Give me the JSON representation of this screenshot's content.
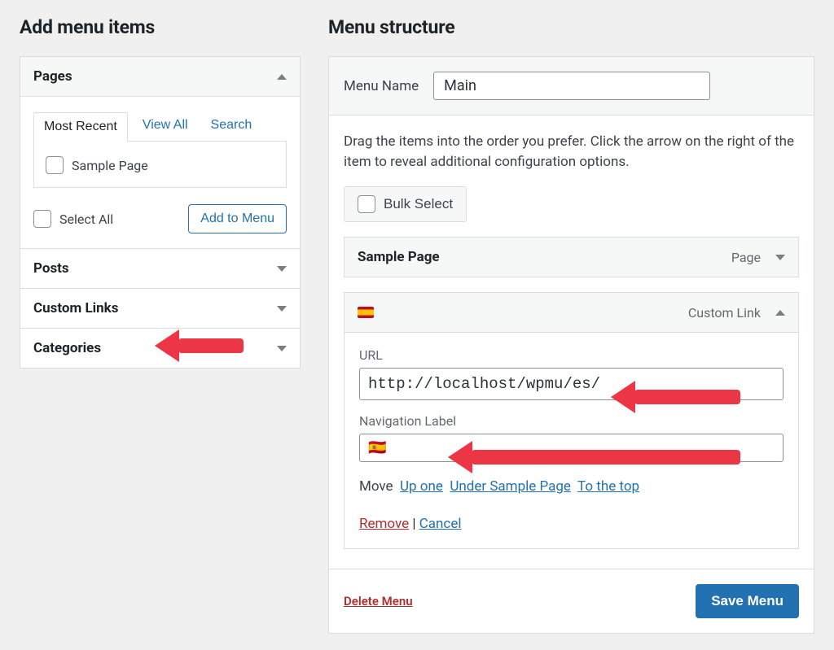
{
  "left": {
    "title": "Add menu items",
    "pages": {
      "header": "Pages",
      "tabs": {
        "recent": "Most Recent",
        "view_all": "View All",
        "search": "Search"
      },
      "items": [
        "Sample Page"
      ],
      "select_all": "Select All",
      "add_to_menu": "Add to Menu"
    },
    "posts_header": "Posts",
    "custom_links_header": "Custom Links",
    "categories_header": "Categories"
  },
  "right": {
    "title": "Menu structure",
    "menu_name_label": "Menu Name",
    "menu_name_value": "Main",
    "instructions": "Drag the items into the order you prefer. Click the arrow on the right of the item to reveal additional configuration options.",
    "bulk_select": "Bulk Select",
    "item_sample": {
      "title": "Sample Page",
      "type": "Page"
    },
    "item_custom": {
      "flag_name": "flag-es-icon",
      "type": "Custom Link",
      "url_label": "URL",
      "url_value": "http://localhost/wpmu/es/",
      "navlabel_label": "Navigation Label",
      "navlabel_value": "🇪🇸",
      "move_label": "Move",
      "move_up": "Up one",
      "move_under": "Under Sample Page",
      "move_top": "To the top",
      "remove": "Remove",
      "cancel": "Cancel"
    },
    "delete_menu": "Delete Menu",
    "save_menu": "Save Menu"
  }
}
